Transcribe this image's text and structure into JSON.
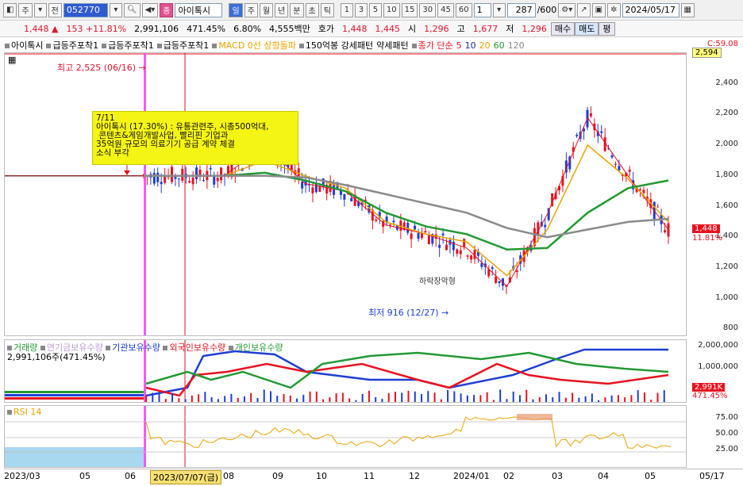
{
  "toolbar": {
    "period_buttons": [
      "주",
      "전"
    ],
    "code": "052770",
    "stock_name": "아이톡시",
    "interval_tabs": [
      "일",
      "주",
      "월",
      "년",
      "분",
      "초",
      "틱"
    ],
    "interval_numbers": [
      "1",
      "3",
      "5",
      "10",
      "15",
      "30",
      "45",
      "60",
      "1"
    ],
    "count": "287",
    "count_max": "/600",
    "date": "2024/05/17"
  },
  "quote": {
    "price": "1,448",
    "change_arrow": "▲",
    "change": "153",
    "change_pct": "+11.81%",
    "volume": "2,991,106",
    "volume_pct": "471.45%",
    "turnover_pct": "6.80%",
    "amount": "4,555백만",
    "bid_label": "호가",
    "ask": "1,448",
    "bid": "1,445",
    "open_label": "시",
    "open": "1,296",
    "high_label": "고",
    "high": "1,677",
    "low_label": "저",
    "low": "1,296",
    "buy": "매수",
    "sell": "매도",
    "flat": "평"
  },
  "legend": [
    "아이톡시",
    "급등주포착1",
    "급등주포착1",
    "급등주포착1",
    "MACD 0선 상향돌파",
    "150억봉 강세패턴",
    "약세패턴",
    "종가 단순",
    "5",
    "10",
    "20",
    "60",
    "120"
  ],
  "price_axis": {
    "ticks": [
      "2,400",
      "2,200",
      "2,000",
      "1,800",
      "1,600",
      "1,400",
      "1,200",
      "1,000",
      "800"
    ],
    "top_label": "C:59.08",
    "top_value": "2,594",
    "current": "1,448",
    "current_pct": "11.81%"
  },
  "annotations": {
    "high": "최고 2,525 (06/16)",
    "low": "최저 916 (12/27)",
    "note": "7/11\n아이톡시 (17.30%) : 유통관련주, 시총500억대,\n 콘텐츠&게임개발사업, 빨리핀 기업과\n35억원 규모의 의료기기 공급 계약 체결\n소식 부각",
    "pattern": "하락장악형"
  },
  "volume_pane": {
    "legend": [
      "거래량",
      "연기금보유수량",
      "기관보유수량",
      "외국인보유수량",
      "개인보유수량"
    ],
    "volume_label": "2,991,106주(471.45%)",
    "ticks": [
      "2,000,000",
      "1,000,000"
    ],
    "current": "2,991K",
    "current_pct": "471.45%"
  },
  "rsi_pane": {
    "legend": "RSI 14",
    "ticks": [
      "75.00",
      "50.00",
      "25.00"
    ]
  },
  "date_axis": {
    "labels": [
      "2023/03",
      "05",
      "06",
      "2023/07/07(금)",
      "08",
      "09",
      "10",
      "11",
      "12",
      "2024/01",
      "02",
      "03",
      "04",
      "05",
      "05/17"
    ]
  },
  "chart_data": {
    "type": "line",
    "x": [
      "2023/03",
      "2023/05",
      "2023/06",
      "2023/07",
      "2023/08",
      "2023/09",
      "2023/10",
      "2023/11",
      "2023/12",
      "2024/01",
      "2024/02",
      "2024/03",
      "2024/04",
      "2024/05"
    ],
    "series": [
      {
        "name": "5",
        "values": [
          1800,
          1800,
          1800,
          2000,
          1750,
          1700,
          1480,
          1420,
          1330,
          1080,
          1550,
          2180,
          1800,
          1450
        ]
      },
      {
        "name": "20",
        "values": [
          1800,
          1800,
          1800,
          1900,
          1800,
          1720,
          1500,
          1420,
          1370,
          1150,
          1450,
          2000,
          1780,
          1500
        ]
      },
      {
        "name": "60",
        "values": [
          1800,
          1800,
          1800,
          1820,
          1770,
          1700,
          1560,
          1470,
          1420,
          1320,
          1330,
          1560,
          1720,
          1770
        ]
      },
      {
        "name": "120",
        "values": [
          1800,
          1800,
          1800,
          1800,
          1790,
          1740,
          1680,
          1620,
          1560,
          1460,
          1400,
          1450,
          1500,
          1520
        ]
      }
    ],
    "ylim": [
      750,
      2600
    ],
    "grid": false
  },
  "colors": {
    "up": "#e8121f",
    "down": "#1f3fd2",
    "ma5": "#e8121f",
    "ma10": "#1a2aa8",
    "ma20": "#e8a400",
    "ma60": "#229933",
    "ma120": "#8a8a8a"
  }
}
